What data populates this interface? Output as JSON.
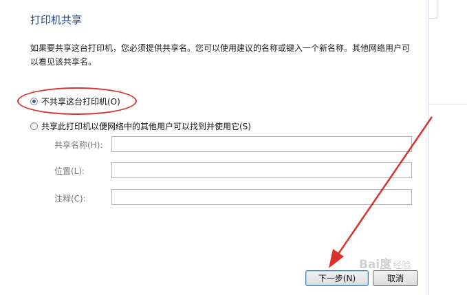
{
  "dialog": {
    "title": "打印机共享",
    "description": "如果要共享这台打印机，您必须提供共享名。您可以使用建议的名称或键入一个新名称。其他网络用户可以看见该共享名。",
    "options": {
      "no_share_label": "不共享这台打印机(O)",
      "share_label": "共享此打印机以便网络中的其他用户可以找到并使用它(S)",
      "selected": "no_share"
    },
    "fields": {
      "share_name_label": "共享名称(H):",
      "share_name_value": "",
      "location_label": "位置(L):",
      "location_value": "",
      "comment_label": "注释(C):",
      "comment_value": ""
    },
    "buttons": {
      "next_label": "下一步(N)",
      "cancel_label": "取消"
    }
  },
  "watermark": {
    "brand": "Bai度",
    "suffix": "经验"
  },
  "colors": {
    "title": "#1b4fa0",
    "annotation": "#d8322b"
  }
}
